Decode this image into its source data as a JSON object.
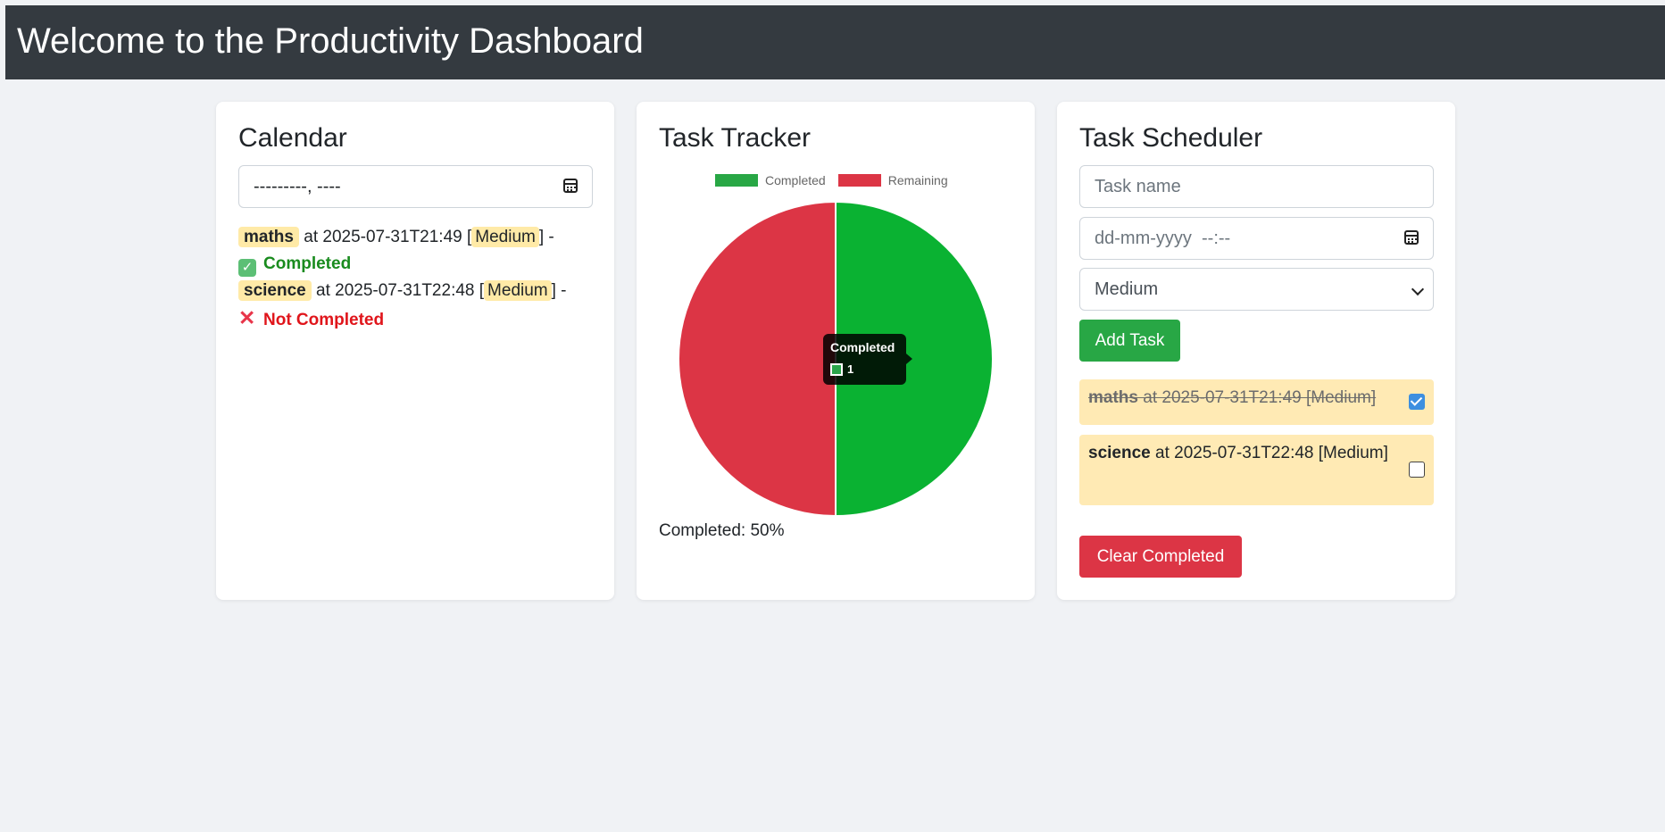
{
  "header": {
    "title": "Welcome to the Productivity Dashboard"
  },
  "calendar": {
    "title": "Calendar",
    "month_input_value": "---------, ----",
    "entries": [
      {
        "name": "maths",
        "at_text": "at 2025-07-31T21:49 [",
        "priority": "Medium",
        "suffix": "] -",
        "status_text": "Completed",
        "status_icon": "check-emoji"
      },
      {
        "name": "science",
        "at_text": "at 2025-07-31T22:48 [",
        "priority": "Medium",
        "suffix": "] -",
        "status_text": "Not Completed",
        "status_icon": "cross-emoji"
      }
    ]
  },
  "tracker": {
    "title": "Task Tracker",
    "completed_text": "Completed: 50%",
    "tooltip": {
      "title": "Completed",
      "value": "1"
    }
  },
  "chart_data": {
    "type": "pie",
    "categories": [
      "Completed",
      "Remaining"
    ],
    "values": [
      1,
      1
    ],
    "colors": [
      "#0ab232",
      "#dc3545"
    ],
    "legend_colors": [
      "#28a745",
      "#dc3545"
    ],
    "legend": "top"
  },
  "scheduler": {
    "title": "Task Scheduler",
    "task_name_placeholder": "Task name",
    "datetime_placeholder": "dd-mm-yyyy  --:--",
    "priority_selected": "Medium",
    "add_button": "Add Task",
    "clear_button": "Clear Completed",
    "tasks": [
      {
        "name": "maths",
        "details": " at 2025-07-31T21:49 [Medium]",
        "completed": true
      },
      {
        "name": "science",
        "details": " at 2025-07-31T22:48 [Medium]",
        "completed": false
      }
    ]
  }
}
